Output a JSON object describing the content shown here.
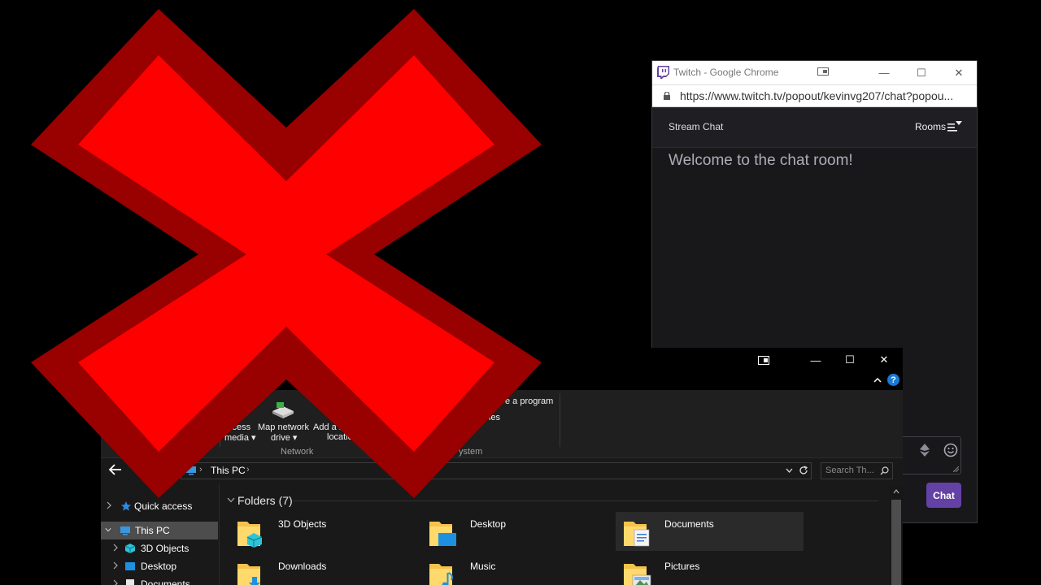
{
  "chrome_window": {
    "title": "Twitch - Google Chrome",
    "url": "https://www.twitch.tv/popout/kevinvg207/chat?popou...",
    "controls": {
      "minimize": "—",
      "maximize": "☐",
      "close": "✕"
    }
  },
  "chat": {
    "header_title": "Stream Chat",
    "rooms_label": "Rooms",
    "welcome_message": "Welcome to the chat room!",
    "send_button": "Chat",
    "accent_color": "#6441a4"
  },
  "explorer": {
    "controls": {
      "minimize": "—",
      "maximize": "☐",
      "close": "✕"
    },
    "help_label": "?",
    "ribbon": {
      "access_media_line1": "ccess",
      "access_media_line2": "media ▾",
      "map_drive_line1": "Map network",
      "map_drive_line2": "drive ▾",
      "add_location_line1": "Add a n",
      "add_location_line2": "locatio",
      "program_label": "e a program",
      "properties_fragment": "ies",
      "network_group": "Network",
      "system_group": "ystem"
    },
    "address": {
      "path": "This PC",
      "search_placeholder": "Search Th..."
    },
    "nav": {
      "items": [
        {
          "label": "Quick access"
        },
        {
          "label": "This PC"
        },
        {
          "label": "3D Objects"
        },
        {
          "label": "Desktop"
        },
        {
          "label": "Documents"
        }
      ]
    },
    "content": {
      "section_title": "Folders (7)",
      "folders": [
        {
          "name": "3D Objects"
        },
        {
          "name": "Desktop"
        },
        {
          "name": "Documents"
        },
        {
          "name": "Downloads"
        },
        {
          "name": "Music"
        },
        {
          "name": "Pictures"
        }
      ]
    }
  },
  "overlay": {
    "icon": "red-x-icon",
    "fill": "#ff0000",
    "border": "#990000"
  }
}
